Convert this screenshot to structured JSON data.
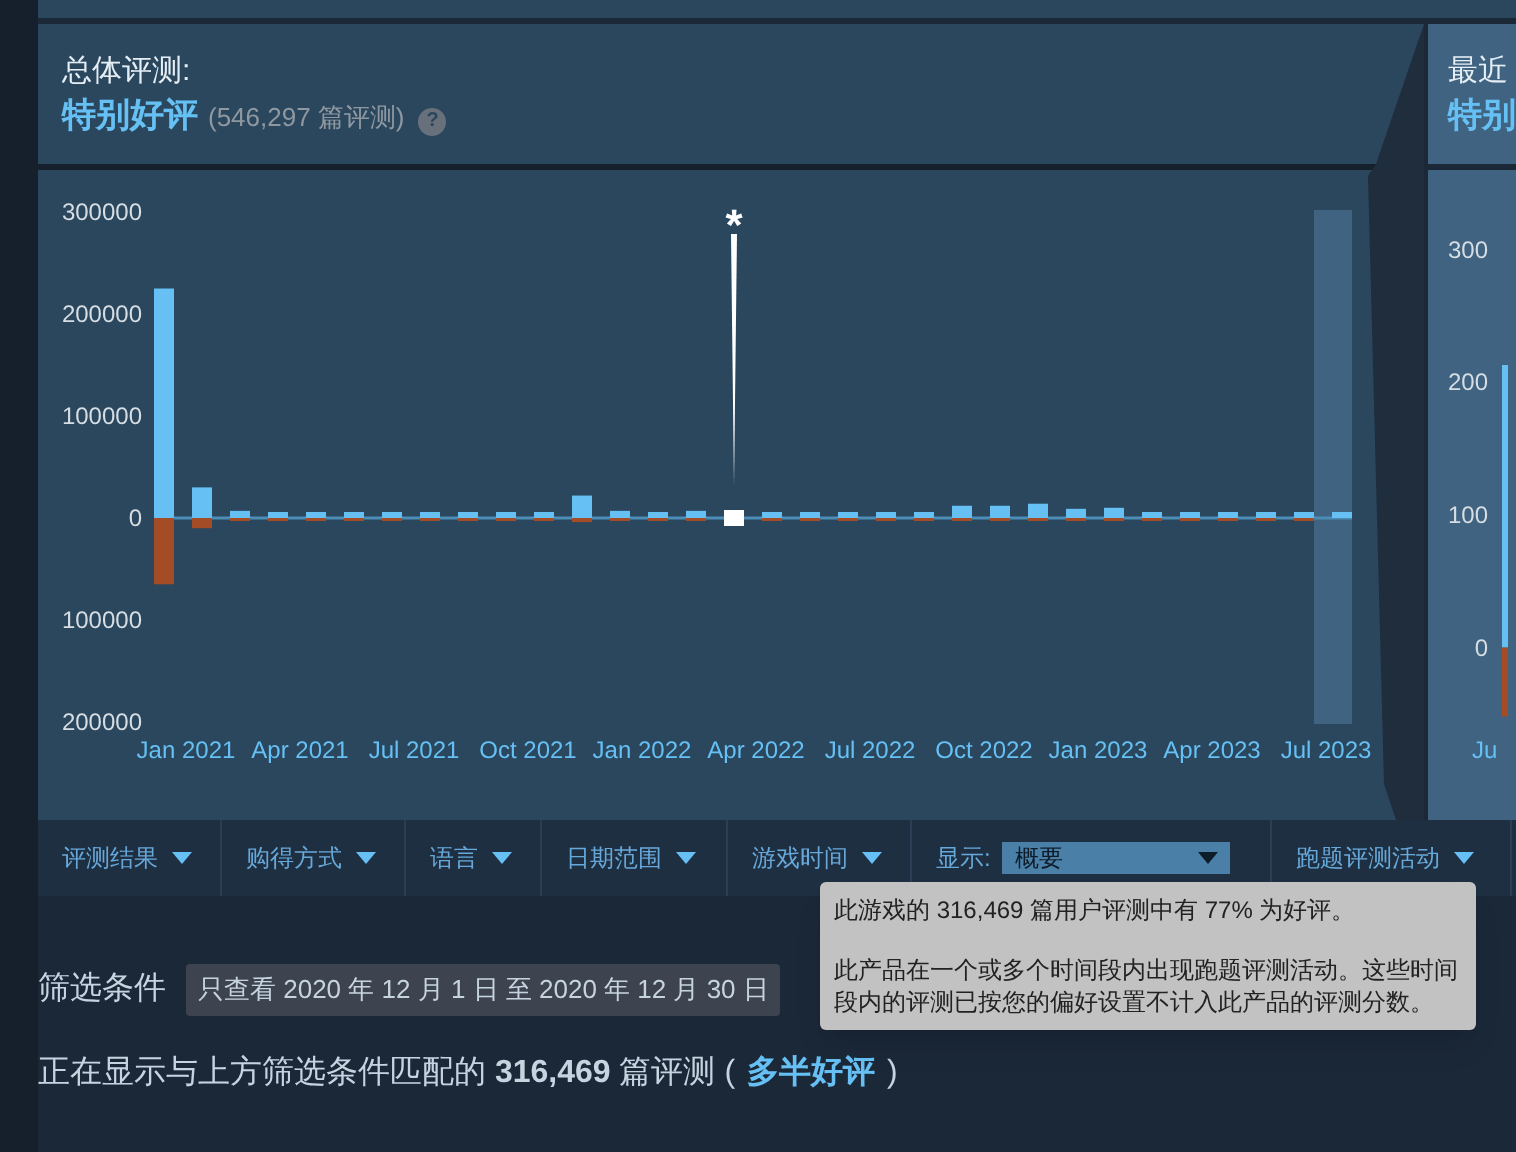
{
  "overall": {
    "title": "总体评测:",
    "rating": "特别好评",
    "count": "(546,297 篇评测)",
    "help": "?",
    "chart_data": {
      "type": "bar",
      "stacked": true,
      "categories": [
        null,
        "Jan 2021",
        null,
        null,
        "Apr 2021",
        null,
        null,
        "Jul 2021",
        null,
        null,
        "Oct 2021",
        null,
        null,
        "Jan 2022",
        null,
        null,
        "Apr 2022",
        null,
        null,
        "Jul 2022",
        null,
        null,
        "Oct 2022",
        null,
        null,
        "Jan 2023",
        null,
        null,
        "Apr 2023",
        null,
        null,
        "Jul 2023"
      ],
      "series": [
        {
          "color": "#66c0f4",
          "values": [
            225000,
            30000,
            7000,
            5000,
            4000,
            3000,
            2000,
            2000,
            2000,
            2000,
            2000,
            22000,
            7000,
            4000,
            7000,
            null,
            2000,
            2000,
            2000,
            2000,
            2000,
            12000,
            12000,
            14000,
            9000,
            10000,
            3000,
            3000,
            4000,
            2000,
            3000,
            2000
          ]
        },
        {
          "color": "#ffffff",
          "values": [
            null,
            null,
            null,
            null,
            null,
            null,
            null,
            null,
            null,
            null,
            null,
            null,
            null,
            null,
            null,
            6000,
            null,
            null,
            null,
            null,
            null,
            null,
            null,
            null,
            null,
            null,
            null,
            null,
            null,
            null,
            null,
            null
          ]
        },
        {
          "color": "#a34c25",
          "values": [
            -65000,
            -10000,
            -3000,
            -3000,
            -2000,
            -2000,
            -2000,
            -1000,
            -1000,
            -1000,
            -1000,
            -4000,
            -3000,
            -2000,
            -2000,
            null,
            -1000,
            -1000,
            -1000,
            -1000,
            -1000,
            -2000,
            -2000,
            -2000,
            -1000,
            -2000,
            -1000,
            -1000,
            -2000,
            -1000,
            -1000,
            null
          ]
        }
      ],
      "ylim": [
        -200000,
        300000
      ],
      "yticks": [
        {
          "value": 300000,
          "label": "300000"
        },
        {
          "value": 200000,
          "label": "200000"
        },
        {
          "value": 100000,
          "label": "100000"
        },
        {
          "value": 0,
          "label": "0"
        },
        {
          "value": -100000,
          "label": "100000"
        },
        {
          "value": -200000,
          "label": "200000"
        }
      ],
      "ref_lines": [
        {
          "axis": "y",
          "value": 0
        }
      ],
      "annotations": [
        "*"
      ]
    }
  },
  "recent": {
    "title": "最近",
    "rating": "特别",
    "chart_data": {
      "type": "bar",
      "stacked": true,
      "categories": [
        "Ju"
      ],
      "ylim": [
        -130,
        360
      ],
      "series": [
        {
          "color": "#66c0f4",
          "values": [
            213
          ]
        },
        {
          "color": "#a34c25",
          "values": [
            -52
          ]
        }
      ],
      "yticks": [
        {
          "value": 300,
          "label": "300"
        },
        {
          "value": 200,
          "label": "200"
        },
        {
          "value": 100,
          "label": "100"
        },
        {
          "value": 0,
          "label": "0"
        }
      ]
    }
  },
  "filters": [
    {
      "kind": "dropdown",
      "label": "评测结果"
    },
    {
      "kind": "dropdown",
      "label": "购得方式"
    },
    {
      "kind": "dropdown",
      "label": "语言"
    },
    {
      "kind": "dropdown",
      "label": "日期范围"
    },
    {
      "kind": "dropdown",
      "label": "游戏时间"
    },
    {
      "kind": "select",
      "label": "显示:",
      "value": "概要"
    },
    {
      "kind": "dropdown",
      "label": "跑题评测活动"
    }
  ],
  "tooltip": {
    "lines": [
      "此游戏的 316,469 篇用户评测中有 77% 为好评。",
      "此产品在一个或多个时间段内出现跑题评测活动。这些时间段内的评测已按您的偏好设置不计入此产品的评测分数。"
    ]
  },
  "active_filter": {
    "label": "筛选条件",
    "chip": "只查看 2020 年 12 月 1 日 至 2020 年 12 月 30 日"
  },
  "summary": {
    "text": "正在显示与上方筛选条件匹配的 **316,469** 篇评测 (",
    "rating": "多半好评",
    "close": ")"
  }
}
